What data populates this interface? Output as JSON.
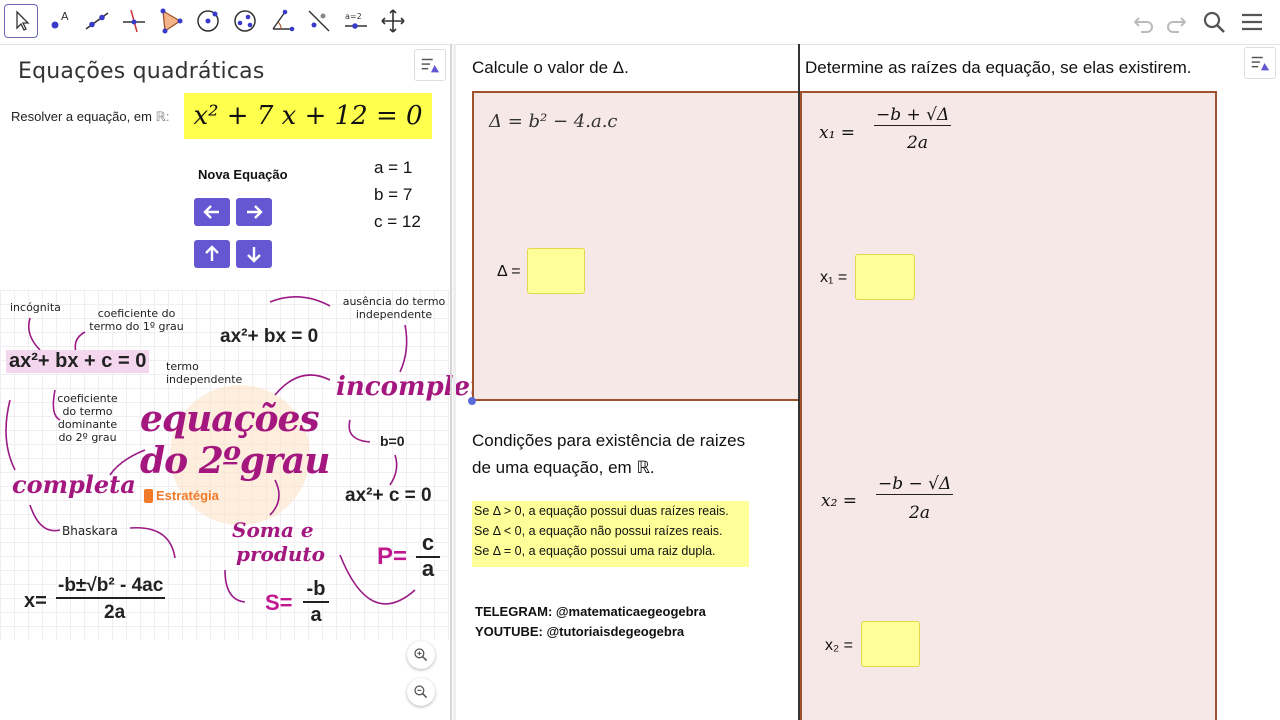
{
  "toolbar": {
    "tools": [
      "move-tool",
      "point-tool",
      "line-tool",
      "perpendicular-tool",
      "polygon-tool",
      "circle-tool",
      "conic-tool",
      "angle-tool",
      "reflect-tool",
      "slider-tool",
      "move-graphics-tool"
    ],
    "slider_label": "a=2",
    "right": [
      "undo",
      "redo",
      "search",
      "menu"
    ]
  },
  "left_panel": {
    "title": "Equações quadráticas",
    "solve_label": "Resolver a equação, em",
    "real_symbol": "ℝ:",
    "equation": "x² + 7 x + 12  = 0",
    "new_equation_label": "Nova Equação",
    "coefficients": [
      "a = 1",
      "b = 7",
      "c = 12"
    ]
  },
  "sketch": {
    "incognita": "incógnita",
    "coef1": "coeficiente do termo do 1º grau",
    "ausencia": "ausência do termo independente",
    "eq_b": "ax²+ bx = 0",
    "eq_full": "ax²+ bx + c = 0",
    "termo_ind": "termo independente",
    "coef_dom": "coeficiente do termo dominante do 2º grau",
    "title_1": "equações",
    "title_2": "do 2ºgrau",
    "incompleta": "incompleta",
    "b0": "b=0",
    "completa": "completa",
    "eq_c": "ax²+ c = 0",
    "brand": "Estratégia",
    "bhaskara": "Bhaskara",
    "soma_1": "Soma e",
    "soma_2": "produto",
    "bhask_lhs": "x=",
    "bhask_num": "-b±√b² - 4ac",
    "bhask_den": "2a",
    "s_lhs": "S=",
    "s_num": "-b",
    "s_den": "a",
    "p_lhs": "P=",
    "p_num": "c",
    "p_den": "a"
  },
  "middle_panel": {
    "heading": "Calcule o valor de Δ.",
    "delta_formula": "Δ = b² − 4.a.c",
    "delta_label": "Δ =",
    "conditions_1": "Condições para existência de raizes",
    "conditions_2": "de uma equação, em ℝ.",
    "rules": [
      "Se Δ > 0, a equação possui duas raízes reais.",
      "Se Δ < 0, a equação não possui raízes reais.",
      "Se Δ = 0, a equação possui uma raiz dupla."
    ],
    "telegram": "TELEGRAM: @matematicaegeogebra",
    "youtube": "YOUTUBE: @tutoriaisdegeogebra"
  },
  "right_panel": {
    "heading": "Determine as raízes da equação, se elas existirem.",
    "x1_lhs": "x₁ =",
    "x1_num": "−b + √Δ",
    "x1_den": "2a",
    "x1_label": "x₁ =",
    "x2_lhs": "x₂ =",
    "x2_num": "−b − √Δ",
    "x2_den": "2a",
    "x2_label": "x₂ ="
  },
  "colors": {
    "accent": "#6557d2",
    "box_fill": "#f6e8e6",
    "box_border": "#a0522d",
    "yellow": "#ffff99",
    "magenta": "#b0198f"
  }
}
